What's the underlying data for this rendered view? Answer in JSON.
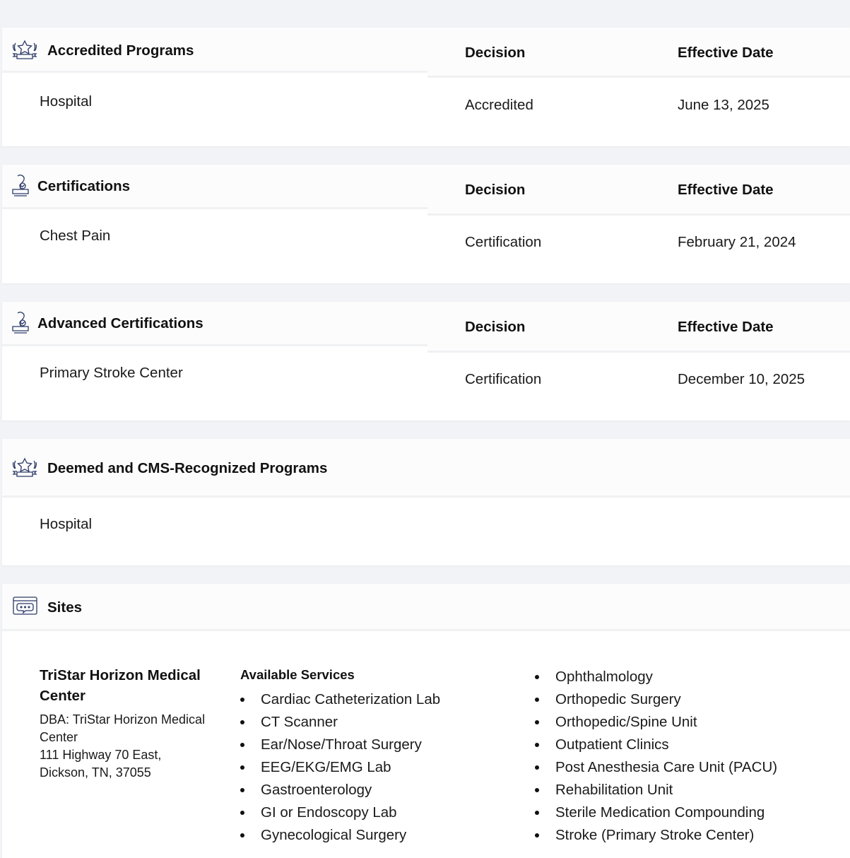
{
  "sections": {
    "accredited": {
      "title": "Accredited Programs",
      "decision_header": "Decision",
      "date_header": "Effective Date",
      "program": "Hospital",
      "decision": "Accredited",
      "date": "June 13, 2025",
      "icon": "award-ribbon-icon"
    },
    "certifications": {
      "title": "Certifications",
      "decision_header": "Decision",
      "date_header": "Effective Date",
      "program": "Chest Pain",
      "decision": "Certification",
      "date": "February 21, 2024",
      "icon": "certificate-stamp-icon"
    },
    "advanced": {
      "title": "Advanced Certifications",
      "decision_header": "Decision",
      "date_header": "Effective Date",
      "program": "Primary Stroke Center",
      "decision": "Certification",
      "date": "December 10, 2025",
      "icon": "certificate-stamp-icon"
    },
    "deemed": {
      "title": "Deemed and CMS-Recognized Programs",
      "program": "Hospital",
      "icon": "award-ribbon-icon"
    },
    "sites": {
      "title": "Sites",
      "icon": "chat-window-icon",
      "site_name": "TriStar Horizon Medical Center",
      "dba_line1": "DBA: TriStar Horizon Medical Center",
      "address_line1": "111 Highway 70 East,",
      "address_line2": "Dickson, TN, 37055",
      "services_title": "Available Services",
      "services_col1": [
        "Cardiac Catheterization Lab",
        "CT Scanner",
        "Ear/Nose/Throat Surgery",
        "EEG/EKG/EMG Lab",
        "Gastroenterology",
        "GI or Endoscopy Lab",
        "Gynecological Surgery"
      ],
      "services_col2": [
        "Ophthalmology",
        "Orthopedic Surgery",
        "Orthopedic/Spine Unit",
        "Outpatient Clinics",
        "Post Anesthesia Care Unit (PACU)",
        "Rehabilitation Unit",
        "Sterile Medication Compounding",
        "Stroke (Primary Stroke Center)"
      ]
    }
  },
  "colors": {
    "page_bg": "#f1f3f6",
    "card_bg": "#ffffff",
    "icon_stroke": "#2c3a66"
  }
}
